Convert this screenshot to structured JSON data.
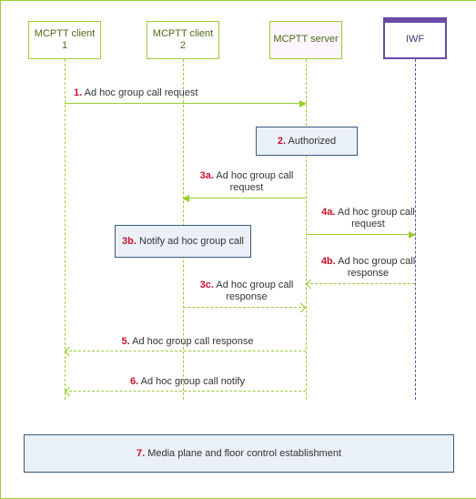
{
  "participants": {
    "p1": "MCPTT client 1",
    "p2": "MCPTT client 2",
    "p3": "MCPTT server",
    "p4": "IWF"
  },
  "steps": {
    "s1_num": "1.",
    "s1_text": "Ad hoc group call request",
    "s2_num": "2.",
    "s2_text": "Authorized",
    "s3a_num": "3a.",
    "s3a_text": "Ad hoc group call request",
    "s3b_num": "3b.",
    "s3b_text": "Notify ad hoc group call",
    "s3c_num": "3c.",
    "s3c_text": "Ad hoc group call response",
    "s4a_num": "4a.",
    "s4a_text": "Ad hoc group call request",
    "s4b_num": "4b.",
    "s4b_text": "Ad hoc group call response",
    "s5_num": "5.",
    "s5_text": "Ad hoc group call response",
    "s6_num": "6.",
    "s6_text": "Ad hoc group call notify",
    "s7_num": "7.",
    "s7_text": "Media plane and floor control establishment"
  },
  "chart_data": {
    "type": "sequence-diagram",
    "participants": [
      "MCPTT client 1",
      "MCPTT client 2",
      "MCPTT server",
      "IWF"
    ],
    "messages": [
      {
        "id": "1",
        "from": "MCPTT client 1",
        "to": "MCPTT server",
        "label": "Ad hoc group call request",
        "style": "solid"
      },
      {
        "id": "2",
        "at": "MCPTT server",
        "label": "Authorized",
        "kind": "note"
      },
      {
        "id": "3a",
        "from": "MCPTT server",
        "to": "MCPTT client 2",
        "label": "Ad hoc group call request",
        "style": "solid"
      },
      {
        "id": "3b",
        "at": "MCPTT client 2",
        "label": "Notify ad hoc group call",
        "kind": "note"
      },
      {
        "id": "3c",
        "from": "MCPTT client 2",
        "to": "MCPTT server",
        "label": "Ad hoc group call response",
        "style": "dashed"
      },
      {
        "id": "4a",
        "from": "MCPTT server",
        "to": "IWF",
        "label": "Ad hoc group call request",
        "style": "solid"
      },
      {
        "id": "4b",
        "from": "IWF",
        "to": "MCPTT server",
        "label": "Ad hoc group call response",
        "style": "dashed"
      },
      {
        "id": "5",
        "from": "MCPTT server",
        "to": "MCPTT client 1",
        "label": "Ad hoc group call response",
        "style": "dashed"
      },
      {
        "id": "6",
        "from": "MCPTT server",
        "to": "MCPTT client 1",
        "label": "Ad hoc group call notify",
        "style": "dashed"
      },
      {
        "id": "7",
        "span": [
          "MCPTT client 1",
          "MCPTT client 2",
          "MCPTT server",
          "IWF"
        ],
        "label": "Media plane and floor control establishment",
        "kind": "note"
      }
    ]
  }
}
